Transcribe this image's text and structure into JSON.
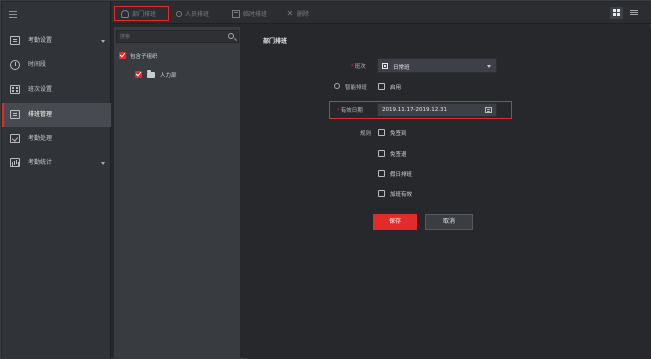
{
  "nav": {
    "items": [
      {
        "label": "考勤设置",
        "icon": "settings-icon",
        "expandable": true
      },
      {
        "label": "时间段",
        "icon": "clock-icon",
        "expandable": false
      },
      {
        "label": "班次设置",
        "icon": "shift-icon",
        "expandable": false
      },
      {
        "label": "排班管理",
        "icon": "schedule-icon",
        "expandable": false,
        "active": true
      },
      {
        "label": "考勤处理",
        "icon": "process-icon",
        "expandable": false
      },
      {
        "label": "考勤统计",
        "icon": "statistics-icon",
        "expandable": true
      }
    ]
  },
  "toolbar": {
    "dept_schedule": "部门排班",
    "person_schedule": "人员排班",
    "temp_schedule": "临时排班",
    "delete": "删除"
  },
  "tree": {
    "search_placeholder": "搜索",
    "include_sub_org": "包含子组织",
    "dept_name": "人力部"
  },
  "form": {
    "title": "部门排班",
    "shift_label": "班次",
    "shift_value": "日常班",
    "smart_schedule_label": "智能排班",
    "enable_label": "启用",
    "valid_date_label": "有效日期",
    "valid_date_value": "2019.11.17-2019.12.31",
    "rules_label": "规则",
    "rules": [
      "免签到",
      "免签退",
      "假日排班",
      "加班有效"
    ],
    "save": "保存",
    "cancel": "取消"
  },
  "colors": {
    "accent": "#e42b2b",
    "background": "#26282c",
    "nav_background": "#303338",
    "panel_background": "#383b40"
  }
}
